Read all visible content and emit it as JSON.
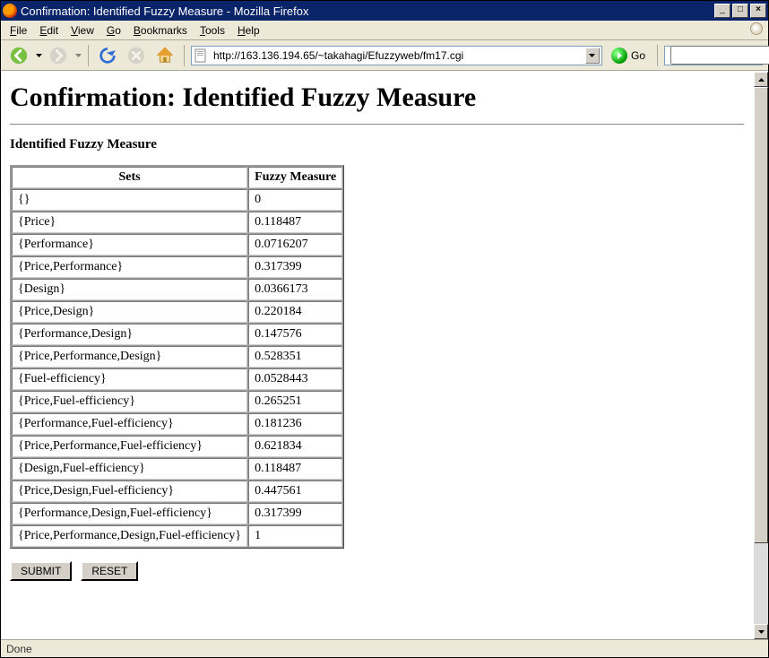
{
  "window": {
    "title": "Confirmation: Identified Fuzzy Measure - Mozilla Firefox"
  },
  "menu": {
    "file": "File",
    "edit": "Edit",
    "view": "View",
    "go": "Go",
    "bookmarks": "Bookmarks",
    "tools": "Tools",
    "help": "Help"
  },
  "toolbar": {
    "url": "http://163.136.194.65/~takahagi/Efuzzyweb/fm17.cgi",
    "go_label": "Go"
  },
  "page": {
    "heading": "Confirmation: Identified Fuzzy Measure",
    "subheading": "Identified Fuzzy Measure",
    "table": {
      "headers": {
        "sets": "Sets",
        "measure": "Fuzzy Measure"
      },
      "rows": [
        {
          "set": "{}",
          "value": "0"
        },
        {
          "set": "{Price}",
          "value": "0.118487"
        },
        {
          "set": "{Performance}",
          "value": "0.0716207"
        },
        {
          "set": "{Price,Performance}",
          "value": "0.317399"
        },
        {
          "set": "{Design}",
          "value": "0.0366173"
        },
        {
          "set": "{Price,Design}",
          "value": "0.220184"
        },
        {
          "set": "{Performance,Design}",
          "value": "0.147576"
        },
        {
          "set": "{Price,Performance,Design}",
          "value": "0.528351"
        },
        {
          "set": "{Fuel-efficiency}",
          "value": "0.0528443"
        },
        {
          "set": "{Price,Fuel-efficiency}",
          "value": "0.265251"
        },
        {
          "set": "{Performance,Fuel-efficiency}",
          "value": "0.181236"
        },
        {
          "set": "{Price,Performance,Fuel-efficiency}",
          "value": "0.621834"
        },
        {
          "set": "{Design,Fuel-efficiency}",
          "value": "0.118487"
        },
        {
          "set": "{Price,Design,Fuel-efficiency}",
          "value": "0.447561"
        },
        {
          "set": "{Performance,Design,Fuel-efficiency}",
          "value": "0.317399"
        },
        {
          "set": "{Price,Performance,Design,Fuel-efficiency}",
          "value": "1"
        }
      ]
    },
    "buttons": {
      "submit": "SUBMIT",
      "reset": "RESET"
    }
  },
  "status": {
    "text": "Done"
  }
}
